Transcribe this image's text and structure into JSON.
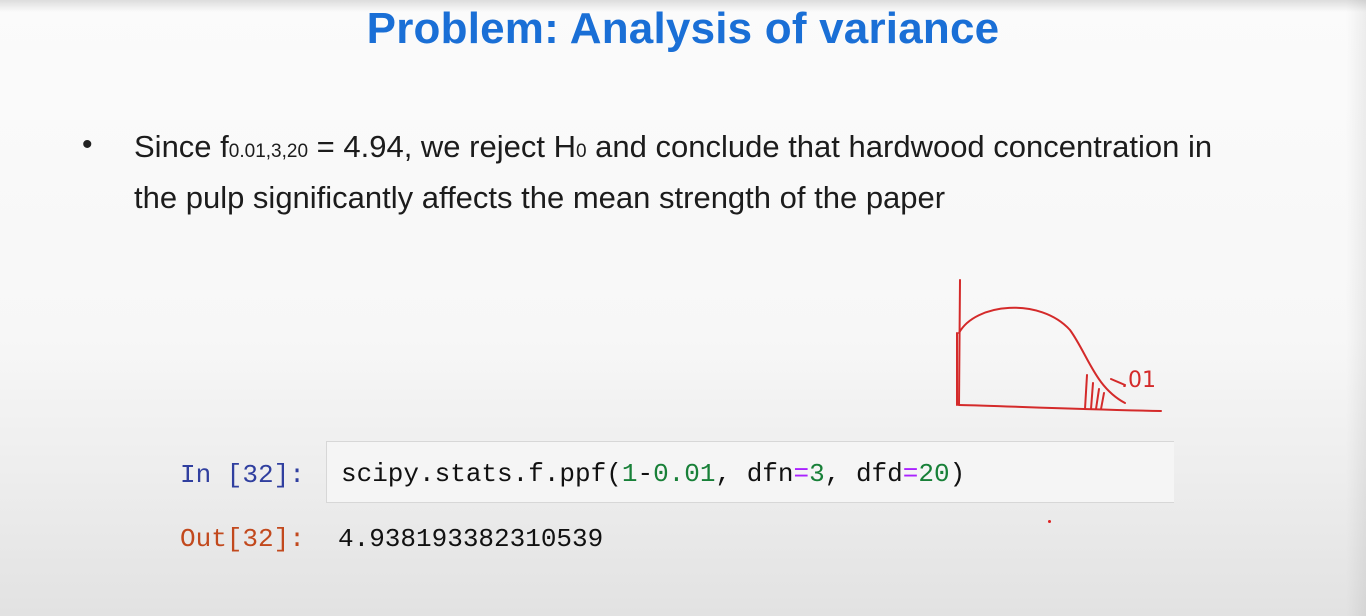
{
  "slide": {
    "title": "Problem: Analysis of variance",
    "bullet": {
      "symbol": "•",
      "p1": "Since f",
      "sub1": "0.01,3,20",
      "p2": " = 4.94, we reject H",
      "sub2": "0",
      "p3": " and conclude that hardwood concentration in the pulp significantly affects the mean strength of the paper"
    },
    "annotation": {
      "label": ".01",
      "stroke_color": "#d42a2a"
    }
  },
  "notebook": {
    "in_prompt": "In [32]:",
    "out_prompt": "Out[32]:",
    "code": {
      "t1": "scipy.stats.f.ppf(",
      "n1": "1",
      "t2": "-",
      "n2": "0.01",
      "t3": ", dfn",
      "o1": "=",
      "n3": "3",
      "t4": ", dfd",
      "o2": "=",
      "n4": "20",
      "t5": ")"
    },
    "output": "4.938193382310539"
  },
  "colors": {
    "title": "#1a6fd6",
    "in_prompt": "#303f9f",
    "out_prompt": "#c2491d",
    "code_number": "#188038",
    "code_operator": "#aa22ff"
  }
}
